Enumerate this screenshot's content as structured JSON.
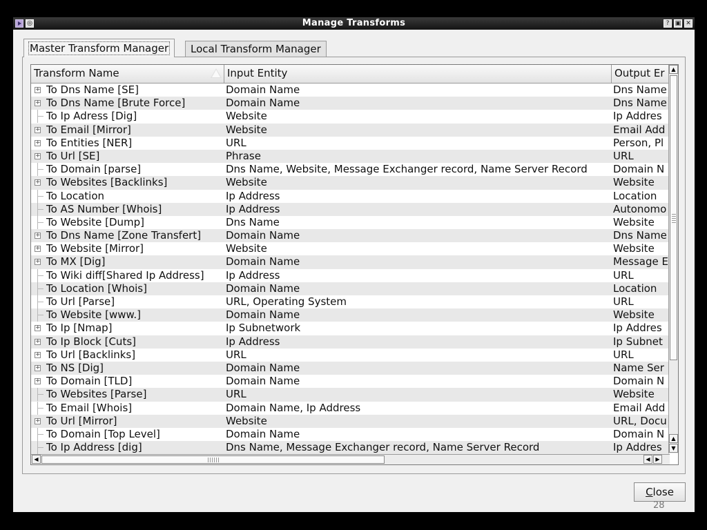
{
  "window": {
    "title": "Manage Transforms",
    "titlebar_icons_left": [
      "app-menu-icon",
      "pin-icon"
    ],
    "titlebar_icons_right": [
      "help-icon",
      "maximize-icon",
      "close-icon"
    ]
  },
  "tabs": [
    {
      "label": "Master Transform Manager",
      "selected": true
    },
    {
      "label": "Local Transform Manager",
      "selected": false
    }
  ],
  "table": {
    "columns": [
      "Transform Name",
      "Input Entity",
      "Output Er"
    ],
    "sort_column": "Transform Name",
    "rows": [
      {
        "name": "To Dns Name [SE]",
        "input": "Domain Name",
        "output": "Dns Name",
        "expandable": true
      },
      {
        "name": "To Dns Name [Brute Force]",
        "input": "Domain Name",
        "output": "Dns Name",
        "expandable": true
      },
      {
        "name": "To Ip Adress [Dig]",
        "input": "Website",
        "output": "Ip Addres",
        "expandable": false
      },
      {
        "name": "To Email [Mirror]",
        "input": "Website",
        "output": "Email Add",
        "expandable": true
      },
      {
        "name": "To Entities [NER]",
        "input": "URL",
        "output": "Person, Pl",
        "expandable": true
      },
      {
        "name": "To Url [SE]",
        "input": "Phrase",
        "output": "URL",
        "expandable": true
      },
      {
        "name": "To Domain [parse]",
        "input": "Dns Name, Website, Message Exchanger record, Name Server Record",
        "output": "Domain N",
        "expandable": false
      },
      {
        "name": "To Websites [Backlinks]",
        "input": "Website",
        "output": "Website",
        "expandable": true
      },
      {
        "name": "To Location",
        "input": "Ip Address",
        "output": "Location",
        "expandable": false
      },
      {
        "name": "To AS Number [Whois]",
        "input": "Ip Address",
        "output": "Autonomo",
        "expandable": false
      },
      {
        "name": "To Website [Dump]",
        "input": "Dns Name",
        "output": "Website",
        "expandable": false
      },
      {
        "name": "To Dns Name [Zone Transfert]",
        "input": "Domain Name",
        "output": "Dns Name",
        "expandable": true
      },
      {
        "name": "To Website [Mirror]",
        "input": "Website",
        "output": "Website",
        "expandable": true
      },
      {
        "name": "To MX [Dig]",
        "input": "Domain Name",
        "output": "Message E",
        "expandable": true
      },
      {
        "name": "To Wiki diff[Shared Ip Address]",
        "input": "Ip Address",
        "output": "URL",
        "expandable": false
      },
      {
        "name": "To Location [Whois]",
        "input": "Domain Name",
        "output": "Location",
        "expandable": false
      },
      {
        "name": "To Url [Parse]",
        "input": "URL, Operating System",
        "output": "URL",
        "expandable": false
      },
      {
        "name": "To Website [www.]",
        "input": "Domain Name",
        "output": "Website",
        "expandable": false
      },
      {
        "name": "To Ip [Nmap]",
        "input": "Ip Subnetwork",
        "output": "Ip Addres",
        "expandable": true
      },
      {
        "name": "To Ip Block [Cuts]",
        "input": "Ip Address",
        "output": "Ip Subnet",
        "expandable": true
      },
      {
        "name": "To Url [Backlinks]",
        "input": "URL",
        "output": "URL",
        "expandable": true
      },
      {
        "name": "To NS [Dig]",
        "input": "Domain Name",
        "output": "Name Ser",
        "expandable": true
      },
      {
        "name": "To Domain [TLD]",
        "input": "Domain Name",
        "output": "Domain N",
        "expandable": true
      },
      {
        "name": "To Websites [Parse]",
        "input": "URL",
        "output": "Website",
        "expandable": false
      },
      {
        "name": "To Email [Whois]",
        "input": "Domain Name, Ip Address",
        "output": "Email Add",
        "expandable": false
      },
      {
        "name": "To Url [Mirror]",
        "input": "Website",
        "output": "URL, Docu",
        "expandable": true
      },
      {
        "name": "To Domain [Top Level]",
        "input": "Domain Name",
        "output": "Domain N",
        "expandable": false
      },
      {
        "name": "To Ip Address [dig]",
        "input": "Dns Name, Message Exchanger record, Name Server Record",
        "output": "Ip Addres",
        "expandable": false
      }
    ]
  },
  "buttons": {
    "close_label": "Close",
    "close_mnemonic": "C",
    "close_rest": "lose"
  },
  "footer": {
    "page_number": "28"
  }
}
